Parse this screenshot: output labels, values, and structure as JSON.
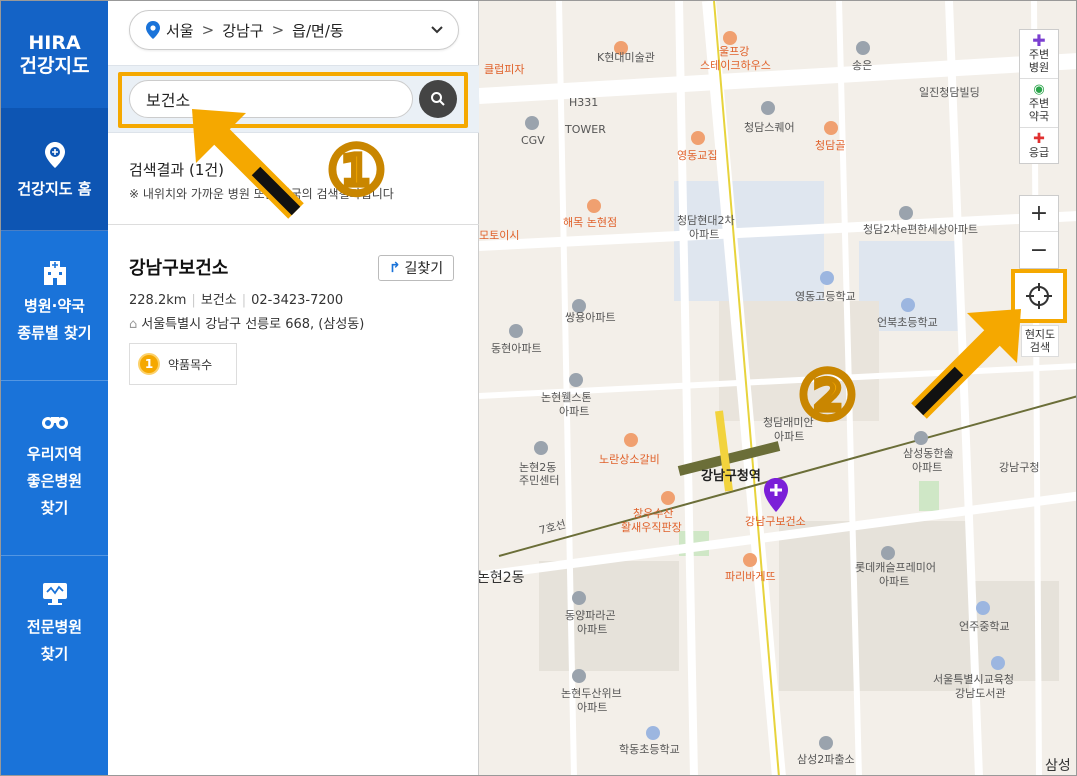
{
  "nav": {
    "logo_line1": "HIRA",
    "logo_line2": "건강지도",
    "items": [
      {
        "label": "건강지도 홈",
        "icon": "location-pin-icon"
      },
      {
        "label_line1": "병원·약국",
        "label_line2": "종류별 찾기",
        "icon": "hospital-building-icon"
      },
      {
        "label_line1": "우리지역",
        "label_line2": "좋은병원",
        "label_line3": "찾기",
        "icon": "binoculars-icon"
      },
      {
        "label_line1": "전문병원",
        "label_line2": "찾기",
        "icon": "monitor-icon"
      }
    ]
  },
  "region": {
    "sido": "서울",
    "sigungu": "강남구",
    "dong": "읍/면/동",
    "sep": ">"
  },
  "search": {
    "value": "보건소"
  },
  "results": {
    "head": "검색결과 (1건)",
    "note": "※ 내위치와 가까운 병원 또는 약국의 검색결과입니다",
    "item": {
      "name": "강남구보건소",
      "route_label": "길찾기",
      "distance": "228.2km",
      "type": "보건소",
      "phone": "02-3423-7200",
      "address": "서울특별시 강남구 선릉로 668, (삼성동)",
      "tag_num": "1",
      "tag_label": "약품목수"
    }
  },
  "steps": {
    "one": "①",
    "two": "②"
  },
  "map_controls": {
    "nearby_hospital": [
      "주변",
      "병원"
    ],
    "nearby_pharmacy": [
      "주변",
      "약국"
    ],
    "emergency": "응급",
    "zoom_in": "+",
    "zoom_out": "−",
    "locate_label": [
      "현지도",
      "검색"
    ]
  },
  "map_labels": {
    "station": "강남구청역",
    "health_center": "강남구보건소",
    "district": "논현2동",
    "line": "7호선",
    "places": [
      "클럽피자",
      "K현대미술관",
      "울프강",
      "스테이크하우스",
      "송은",
      "주변",
      "H331",
      "TOWER",
      "CGV",
      "청담스퀘어",
      "일진청담빌딩",
      "영동교집",
      "청담골",
      "해목 논현점",
      "청담현대2차",
      "아파트",
      "모토이시",
      "청담2차e편한세상아파트",
      "영동고등학교",
      "언북초등학교",
      "쌍용아파트",
      "동현아파트",
      "논현웰스톤",
      "청담래미안",
      "노란상소갈비",
      "논현2동",
      "주민센터",
      "창우수산",
      "활새우직판장",
      "삼성동한솔",
      "강남구청",
      "파리바게뜨",
      "롯데캐슬프레미어",
      "동양파라곤",
      "언주중학교",
      "서울특별시교육청",
      "강남도서관",
      "논현두산위브",
      "학동초등학교",
      "삼성2파출소",
      "삼성"
    ]
  }
}
